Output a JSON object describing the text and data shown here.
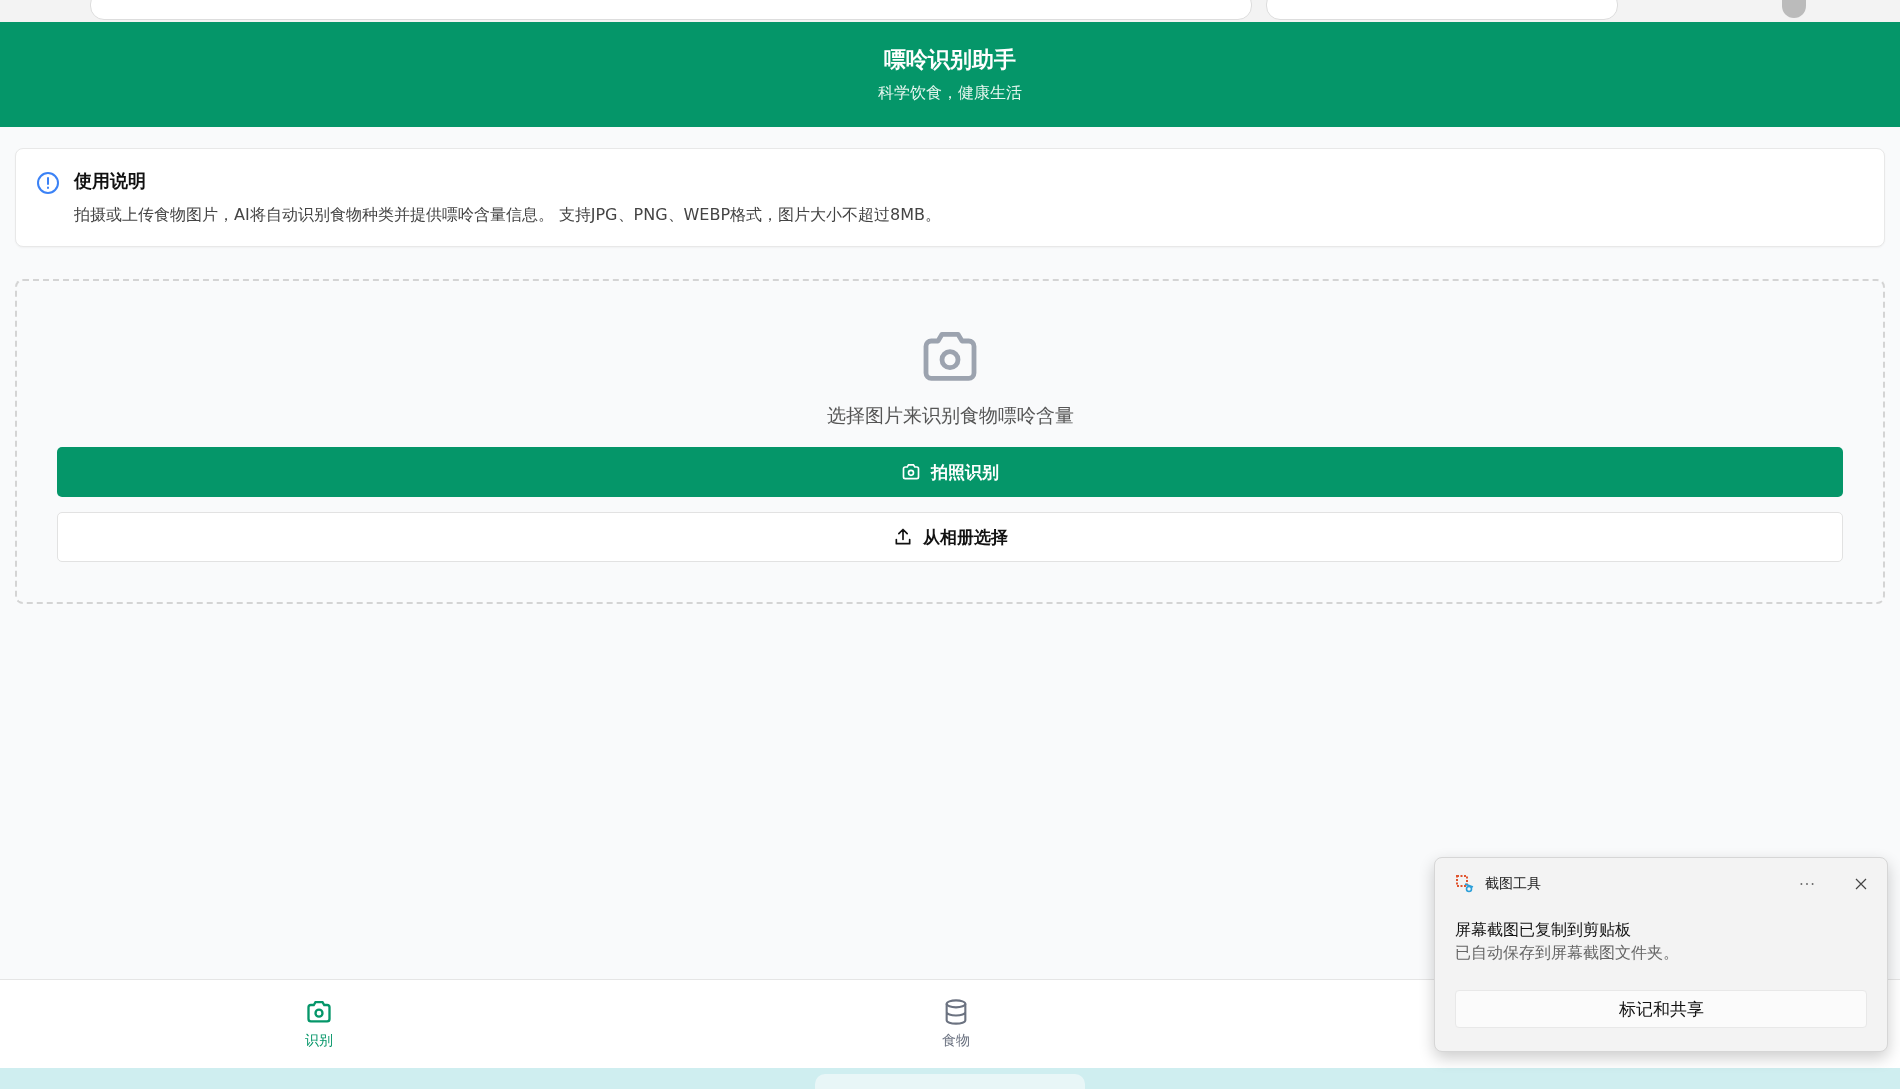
{
  "header": {
    "title": "嘌呤识别助手",
    "subtitle": "科学饮食，健康生活"
  },
  "instructions": {
    "title": "使用说明",
    "text": "拍摄或上传食物图片，AI将自动识别食物种类并提供嘌呤含量信息。 支持JPG、PNG、WEBP格式，图片大小不超过8MB。"
  },
  "upload": {
    "prompt": "选择图片来识别食物嘌呤含量",
    "buttons": [
      {
        "label": "拍照识别",
        "kind": "primary"
      },
      {
        "label": "从相册选择",
        "kind": "secondary"
      }
    ]
  },
  "bottom_nav": [
    {
      "label": "识别",
      "selected": true
    },
    {
      "label": "食物",
      "selected": false
    }
  ],
  "notification": {
    "app": "截图工具",
    "title": "屏幕截图已复制到剪贴板",
    "text": "已自动保存到屏幕截图文件夹。",
    "action": "标记和共享"
  }
}
